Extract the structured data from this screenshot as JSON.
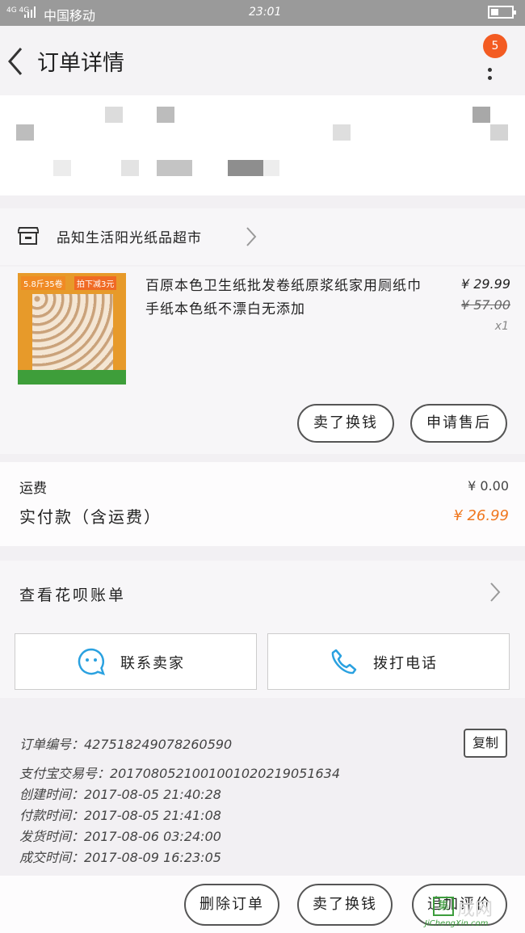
{
  "status_bar": {
    "network": "4G 4G",
    "carrier": "中国移动",
    "time": "23:01"
  },
  "header": {
    "title": "订单详情",
    "badge_count": "5"
  },
  "shop": {
    "name": "品知生活阳光纸品超市"
  },
  "item": {
    "thumb_tag1": "5.8斤35卷",
    "thumb_tag2": "拍下减3元",
    "title": "百原本色卫生纸批发卷纸原浆纸家用厕纸巾手纸本色纸不漂白无添加",
    "price": "¥ 29.99",
    "original_price": "¥ 57.00",
    "quantity": "x1",
    "buttons": [
      "卖了换钱",
      "申请售后"
    ]
  },
  "fees": {
    "shipping_label": "运费",
    "shipping_value": "¥ 0.00",
    "total_label": "实付款（含运费）",
    "total_value": "¥ 26.99"
  },
  "huabei": {
    "label": "查看花呗账单"
  },
  "contact": {
    "seller_label": "联系卖家",
    "call_label": "拨打电话"
  },
  "order_info": {
    "order_no": "订单编号：427518249078260590",
    "copy_label": "复制",
    "alipay_no": "支付宝交易号：2017080521001001020219051634",
    "created": "创建时间：2017-08-05 21:40:28",
    "paid": "付款时间：2017-08-05 21:41:08",
    "shipped": "发货时间：2017-08-06 03:24:00",
    "completed": "成交时间：2017-08-09 16:23:05"
  },
  "footer": {
    "buttons": [
      "删除订单",
      "卖了换钱",
      "追加评价"
    ]
  },
  "watermark": {
    "char": "集",
    "text": "成网",
    "url": "JiChengXin.com"
  },
  "colors": {
    "accent": "#f07820",
    "badge": "#f35b22",
    "icon_blue": "#2aa1e0"
  }
}
